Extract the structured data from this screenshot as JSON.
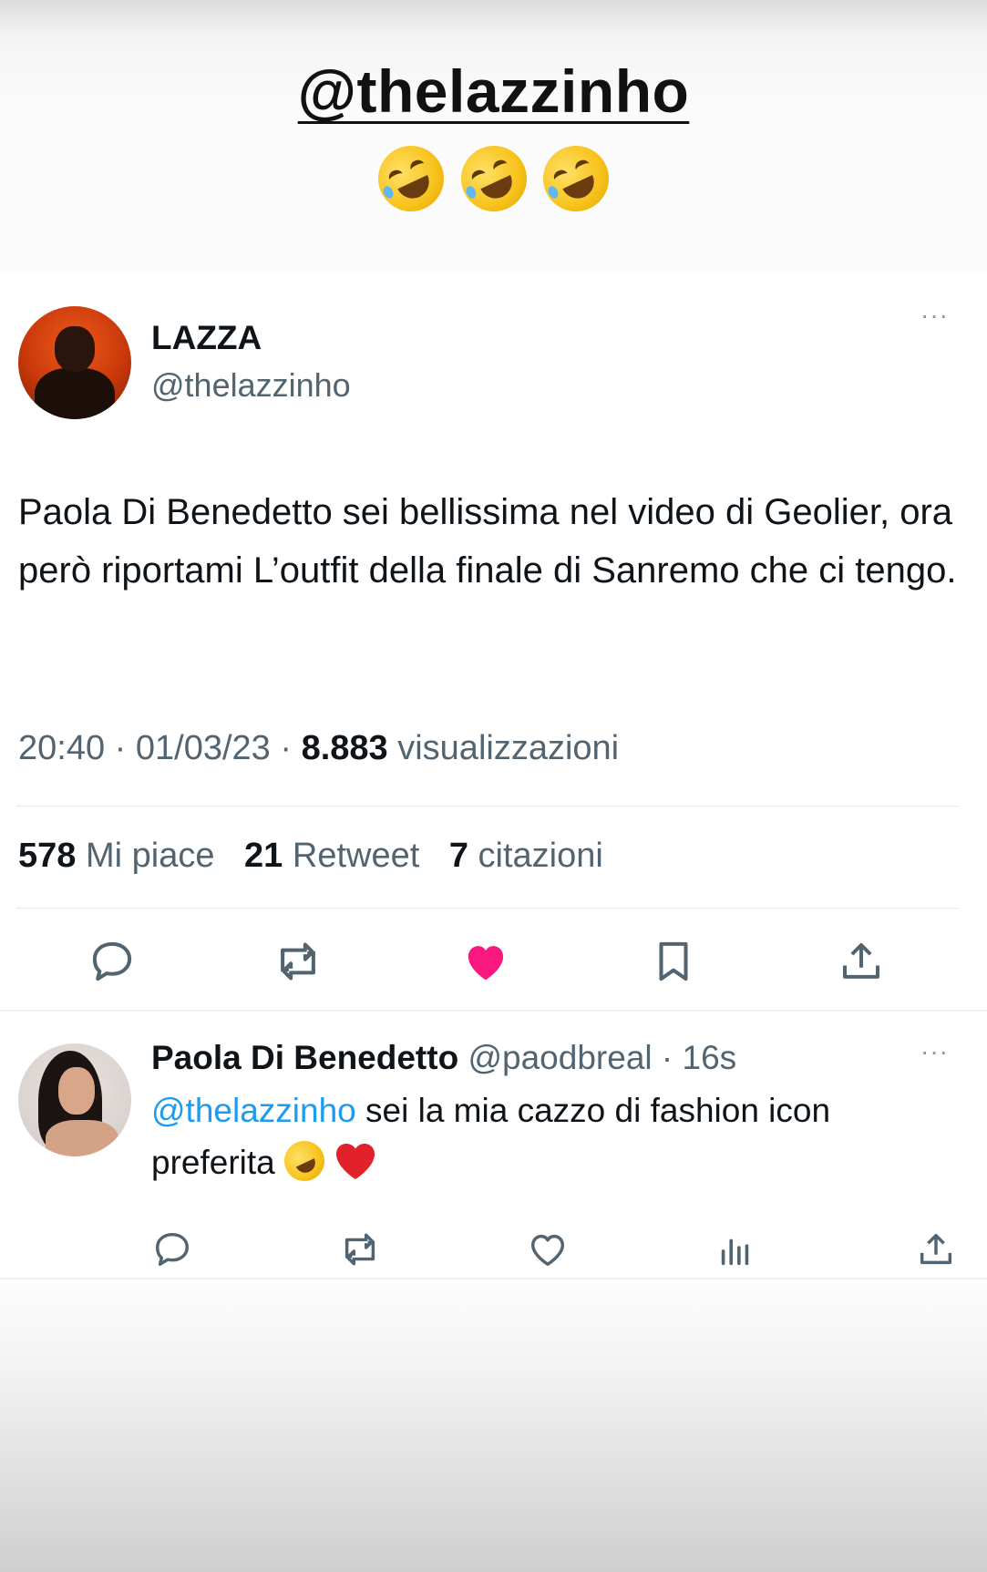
{
  "story": {
    "mention_sticker": "@thelazzinho",
    "sticker_emojis": [
      "rolling-on-floor-laughing-emoji",
      "rolling-on-floor-laughing-emoji",
      "rolling-on-floor-laughing-emoji"
    ]
  },
  "tweet": {
    "author_name": "LAZZA",
    "author_handle": "@thelazzinho",
    "more_label": "···",
    "text": "Paola Di Benedetto sei bellissima nel video di Geolier, ora però riportami L’outfit della finale di Sanremo che ci tengo.",
    "time": "20:40",
    "date": "01/03/23",
    "separator": "·",
    "views_count": "8.883",
    "views_label": "visualizzazioni",
    "likes_count": "578",
    "likes_label": "Mi piace",
    "retweets_count": "21",
    "retweets_label": "Retweet",
    "quotes_count": "7",
    "quotes_label": "citazioni",
    "liked": true,
    "actions": [
      "reply-icon",
      "retweet-icon",
      "like-icon",
      "bookmark-icon",
      "share-icon"
    ],
    "like_color": "#f91880"
  },
  "reply": {
    "author_name": "Paola Di Benedetto",
    "author_handle": "@paodbreal",
    "separator": "·",
    "time_ago": "16s",
    "more_label": "···",
    "mention": "@thelazzinho",
    "text": " sei la mia cazzo di fashion icon preferita ",
    "emojis": [
      "rolling-on-floor-laughing-emoji",
      "red-heart-emoji"
    ],
    "actions": [
      "reply-icon",
      "retweet-icon",
      "like-icon",
      "views-icon",
      "share-icon"
    ]
  },
  "colors": {
    "text_primary": "#0f1419",
    "text_secondary": "#536471",
    "link": "#1d9bf0",
    "divider": "#e6e9eb"
  }
}
